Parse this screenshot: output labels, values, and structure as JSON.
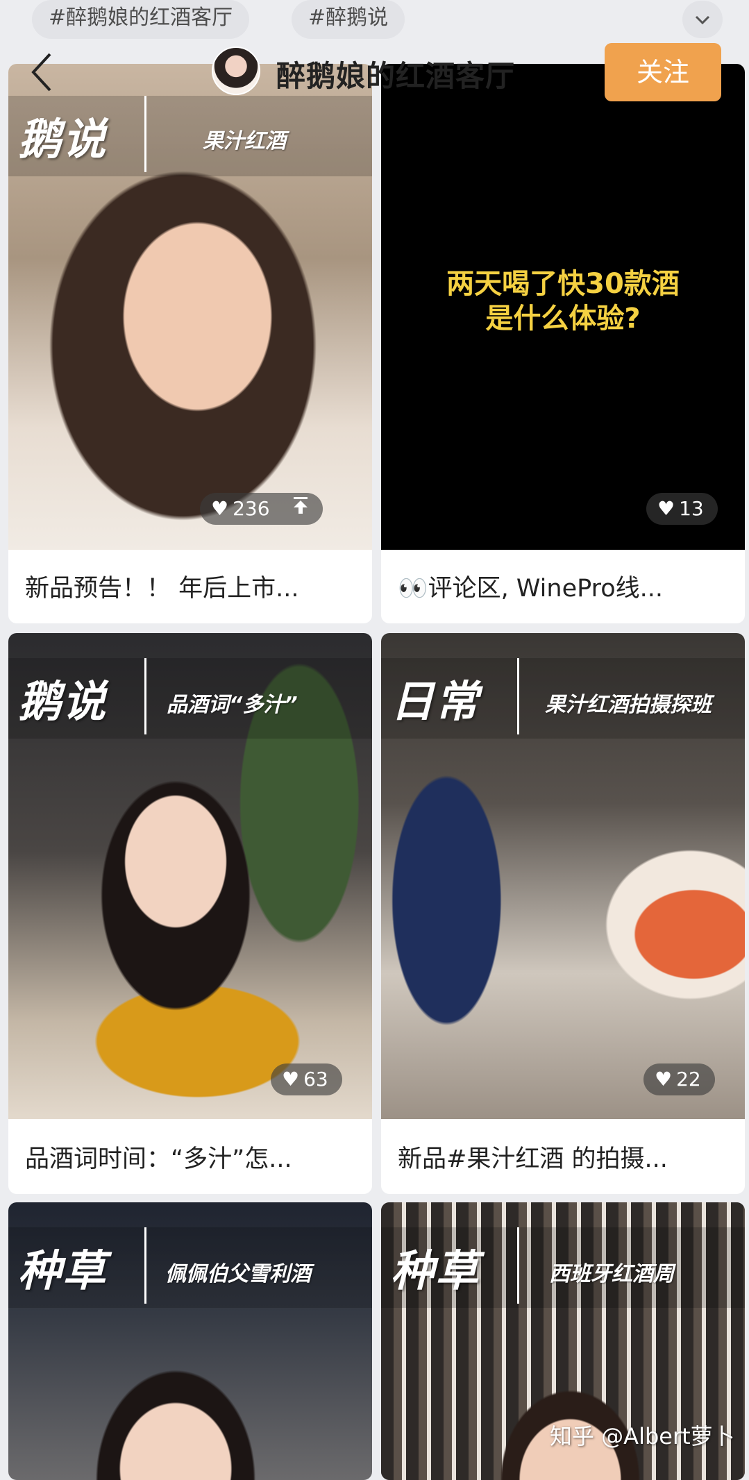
{
  "tags": [
    "#醉鹅娘的红酒客厅",
    "#醉鹅说"
  ],
  "header": {
    "account_name": "醉鹅娘的红酒客厅",
    "follow_label": "关注"
  },
  "cards": [
    {
      "caption": "新品预告！！ 年后上市...",
      "likes": "236",
      "label_big": "鹅说",
      "label_small": "果汁红酒"
    },
    {
      "caption": "👀评论区, WinePro线...",
      "likes": "13",
      "overlay_line1": "两天喝了快30款酒",
      "overlay_line2": "是什么体验?"
    },
    {
      "caption": "品酒词时间：“多汁”怎...",
      "likes": "63",
      "label_big": "鹅说",
      "label_small": "品酒词“多汁”"
    },
    {
      "caption": "新品#果汁红酒 的拍摄...",
      "likes": "22",
      "label_big": "日常",
      "label_small": "果汁红酒拍摄探班"
    },
    {
      "label_big": "种草",
      "label_small": "佩佩伯父雪利酒"
    },
    {
      "label_big": "种草",
      "label_small": "西班牙红酒周"
    }
  ],
  "watermark": "知乎 @Albert萝卜",
  "colors": {
    "background": "#ecedf0",
    "follow_button": "#f0a24e",
    "overlay_text": "#f5d142"
  }
}
